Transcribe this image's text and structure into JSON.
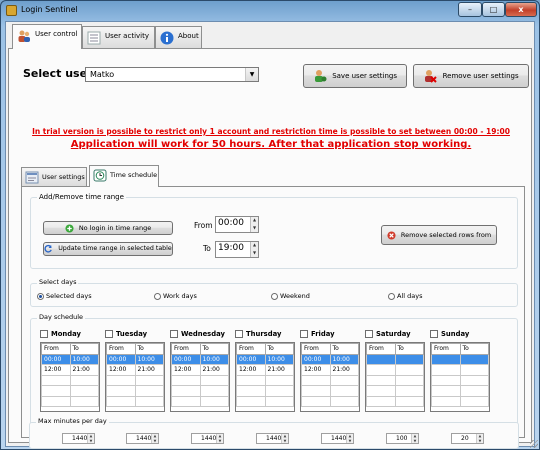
{
  "window": {
    "title": "Login Sentinel",
    "min_label": "–",
    "max_label": "□",
    "close_label": "x"
  },
  "tabs": [
    {
      "label": "User control",
      "icon": "users-icon"
    },
    {
      "label": "User activity",
      "icon": "activity-list-icon"
    },
    {
      "label": "About",
      "icon": "info-icon"
    }
  ],
  "user": {
    "select_label": "Select user",
    "selected": "Matko",
    "save_label": "Save user settings",
    "remove_label": "Remove user settings"
  },
  "trial": {
    "line1": "In trial version is possible to restrict only 1 account and restriction time is possible to set between 00:00 - 19:00",
    "line2": "Application will work for 50 hours. After that application stop working."
  },
  "subtabs": [
    {
      "label": "User settings",
      "icon": "user-settings-icon"
    },
    {
      "label": "Time schedule",
      "icon": "clock-icon"
    }
  ],
  "time_range": {
    "group_title": "Add/Remove time range",
    "no_login_label": "No login in time range",
    "update_label": "Update time range in selected table",
    "from_label": "From",
    "from_value": "00:00",
    "to_label": "To",
    "to_value": "19:00",
    "remove_rows_label": "Remove selected rows from"
  },
  "select_days": {
    "group_title": "Select days",
    "options": [
      "Selected days",
      "Work days",
      "Weekend",
      "All days"
    ],
    "selected_index": 0
  },
  "schedule": {
    "group_title": "Day schedule",
    "col_from": "From",
    "col_to": "To",
    "days": [
      {
        "name": "Monday",
        "rows": [
          [
            "00:00",
            "10:00"
          ],
          [
            "12:00",
            "21:00"
          ]
        ]
      },
      {
        "name": "Tuesday",
        "rows": [
          [
            "00:00",
            "10:00"
          ],
          [
            "12:00",
            "21:00"
          ]
        ]
      },
      {
        "name": "Wednesday",
        "rows": [
          [
            "00:00",
            "10:00"
          ],
          [
            "12:00",
            "21:00"
          ]
        ]
      },
      {
        "name": "Thursday",
        "rows": [
          [
            "00:00",
            "10:00"
          ],
          [
            "12:00",
            "21:00"
          ]
        ]
      },
      {
        "name": "Friday",
        "rows": [
          [
            "00:00",
            "10:00"
          ],
          [
            "12:00",
            "21:00"
          ]
        ]
      },
      {
        "name": "Saturday",
        "rows": []
      },
      {
        "name": "Sunday",
        "rows": []
      }
    ]
  },
  "max_minutes": {
    "group_title": "Max minutes per day",
    "values": [
      "1440",
      "1440",
      "1440",
      "1440",
      "1440",
      "100",
      "20"
    ]
  },
  "colors": {
    "warning_red": "#e20000",
    "selection_blue": "#3d8ee8"
  }
}
